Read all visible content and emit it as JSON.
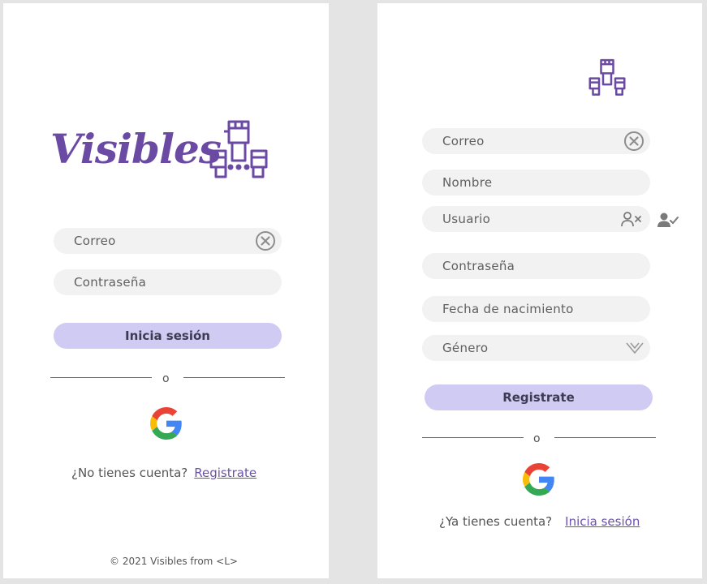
{
  "login": {
    "brand": "Visibles",
    "email_placeholder": "Correo",
    "password_placeholder": "Contraseña",
    "submit_label": "Inicia sesión",
    "or_text": "o",
    "signup_prompt": "¿No tienes cuenta?",
    "signup_link": "Registrate",
    "footer": "© 2021 Visibles from <L>"
  },
  "register": {
    "email_placeholder": "Correo",
    "name_placeholder": "Nombre",
    "username_placeholder": "Usuario",
    "password_placeholder": "Contraseña",
    "birthdate_placeholder": "Fecha de nacimiento",
    "gender_placeholder": "Género",
    "submit_label": "Registrate",
    "or_text": "o",
    "login_prompt": "¿Ya tienes cuenta?",
    "login_link": "Inicia sesión"
  },
  "colors": {
    "accent": "#6b4aa3",
    "button": "#d0cbf3",
    "field": "#f2f2f2",
    "background": "#e4e4e4"
  },
  "icons": {
    "raised_fists": "raised-fists-icon",
    "clear": "clear-circle-x-icon",
    "user_remove": "user-x-icon",
    "user_check": "user-check-icon",
    "chevron": "chevron-down-icon",
    "google": "google-icon"
  }
}
